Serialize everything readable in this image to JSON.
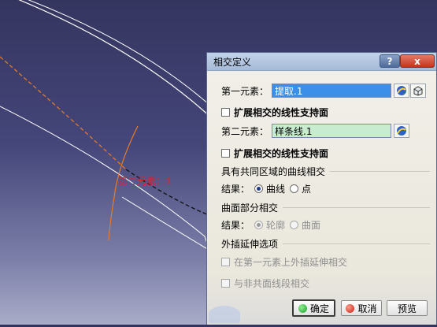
{
  "viewport": {
    "curve_label": "第二元素：1"
  },
  "dialog": {
    "title": "相交定义",
    "help_label": "?",
    "close_label": "x",
    "first_element_label": "第一元素：",
    "first_element_value": "提取.1",
    "extend_support_1_label": "扩展相交的线性支持面",
    "second_element_label": "第二元素：",
    "second_element_value": "样条线.1",
    "extend_support_2_label": "扩展相交的线性支持面",
    "curve_common_area_section": "具有共同区域的曲线相交",
    "result_label_1": "结果：",
    "result_curve_option": "曲线",
    "result_point_option": "点",
    "surface_part_section": "曲面部分相交",
    "result_label_2": "结果：",
    "result_contour_option": "轮廓",
    "result_surface_option": "曲面",
    "extrapolation_section": "外插延伸选项",
    "extrapolate_first_label": "在第一元素上外插延伸相交",
    "non_coplanar_label": "与非共面线段相交",
    "ok_label": "确定",
    "cancel_label": "取消",
    "preview_label": "预览"
  }
}
